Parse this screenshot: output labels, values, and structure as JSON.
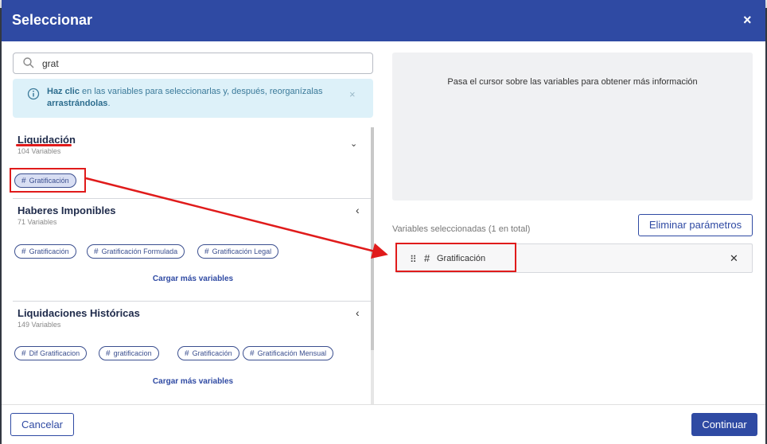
{
  "dialog": {
    "title": "Seleccionar",
    "close_glyph": "×"
  },
  "search": {
    "value": "grat"
  },
  "info": {
    "bold1": "Haz clic",
    "text1": " en las variables para seleccionarlas y, después, reorganízalas ",
    "bold2": "arrastrándolas",
    "text2": ".",
    "close_glyph": "×"
  },
  "groups": [
    {
      "name": "Liquidación",
      "count": "104 Variables",
      "chevron": "⌄",
      "chips": [
        "Gratificación"
      ]
    },
    {
      "name": "Haberes Imponibles",
      "count": "71 Variables",
      "chevron": "‹",
      "chips": [
        "Gratificación",
        "Gratificación Formulada",
        "Gratificación Legal"
      ],
      "load_more": "Cargar más variables"
    },
    {
      "name": "Liquidaciones Históricas",
      "count": "149 Variables",
      "chevron": "‹",
      "chips": [
        "Dif Gratificacion",
        "gratificacion",
        "Gratificación",
        "Gratificación Mensual"
      ],
      "load_more": "Cargar más variables"
    }
  ],
  "chip_hash": "#",
  "hover_info": "Pasa el cursor sobre las variables para obtener más información",
  "selected": {
    "label": "Variables seleccionadas (1 en total)",
    "clear_button": "Eliminar parámetros",
    "drag_glyph": "⠿",
    "hash": "#",
    "items": [
      "Gratificación"
    ],
    "remove_glyph": "✕"
  },
  "footer": {
    "cancel": "Cancelar",
    "continue": "Continuar"
  },
  "colors": {
    "header": "#2f4aa3",
    "annotation": "#e01b1b",
    "info_bg": "#ddf1f9"
  }
}
